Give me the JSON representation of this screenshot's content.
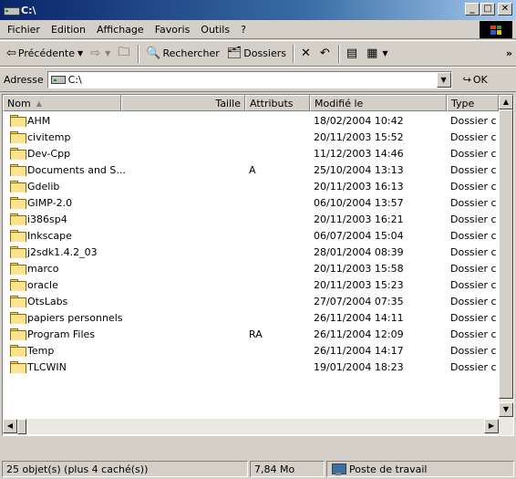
{
  "window": {
    "title": "C:\\"
  },
  "menu": [
    "Fichier",
    "Edition",
    "Affichage",
    "Favoris",
    "Outils",
    "?"
  ],
  "toolbar": {
    "back_label": "Précédente",
    "search_label": "Rechercher",
    "folders_label": "Dossiers",
    "overflow": "»"
  },
  "address": {
    "label": "Adresse",
    "value": "C:\\",
    "go_label": "OK"
  },
  "columns": {
    "name": "Nom",
    "size": "Taille",
    "attributes": "Attributs",
    "modified": "Modifié le",
    "type": "Type"
  },
  "files": [
    {
      "name": "AHM",
      "attr": "",
      "modified": "18/02/2004 10:42",
      "type": "Dossier c"
    },
    {
      "name": "civitemp",
      "attr": "",
      "modified": "20/11/2003 15:52",
      "type": "Dossier c"
    },
    {
      "name": "Dev-Cpp",
      "attr": "",
      "modified": "11/12/2003 14:46",
      "type": "Dossier c"
    },
    {
      "name": "Documents and S...",
      "attr": "A",
      "modified": "25/10/2004 13:13",
      "type": "Dossier c"
    },
    {
      "name": "Gdelib",
      "attr": "",
      "modified": "20/11/2003 16:13",
      "type": "Dossier c"
    },
    {
      "name": "GIMP-2.0",
      "attr": "",
      "modified": "06/10/2004 13:57",
      "type": "Dossier c"
    },
    {
      "name": "i386sp4",
      "attr": "",
      "modified": "20/11/2003 16:21",
      "type": "Dossier c"
    },
    {
      "name": "Inkscape",
      "attr": "",
      "modified": "06/07/2004 15:04",
      "type": "Dossier c"
    },
    {
      "name": "j2sdk1.4.2_03",
      "attr": "",
      "modified": "28/01/2004 08:39",
      "type": "Dossier c"
    },
    {
      "name": "marco",
      "attr": "",
      "modified": "20/11/2003 15:58",
      "type": "Dossier c"
    },
    {
      "name": "oracle",
      "attr": "",
      "modified": "20/11/2003 15:23",
      "type": "Dossier c"
    },
    {
      "name": "OtsLabs",
      "attr": "",
      "modified": "27/07/2004 07:35",
      "type": "Dossier c"
    },
    {
      "name": "papiers personnels",
      "attr": "",
      "modified": "26/11/2004 14:11",
      "type": "Dossier c"
    },
    {
      "name": "Program Files",
      "attr": "RA",
      "modified": "26/11/2004 12:09",
      "type": "Dossier c"
    },
    {
      "name": "Temp",
      "attr": "",
      "modified": "26/11/2004 14:17",
      "type": "Dossier c"
    },
    {
      "name": "TLCWIN",
      "attr": "",
      "modified": "19/01/2004 18:23",
      "type": "Dossier c"
    }
  ],
  "status": {
    "objects": "25 objet(s) (plus 4 caché(s))",
    "size": "7,84 Mo",
    "location": "Poste de travail"
  },
  "colors": {
    "titlebar_start": "#0a246a",
    "titlebar_end": "#a6caf0",
    "chrome": "#d4d0c8",
    "folder": "#fbe38f"
  }
}
